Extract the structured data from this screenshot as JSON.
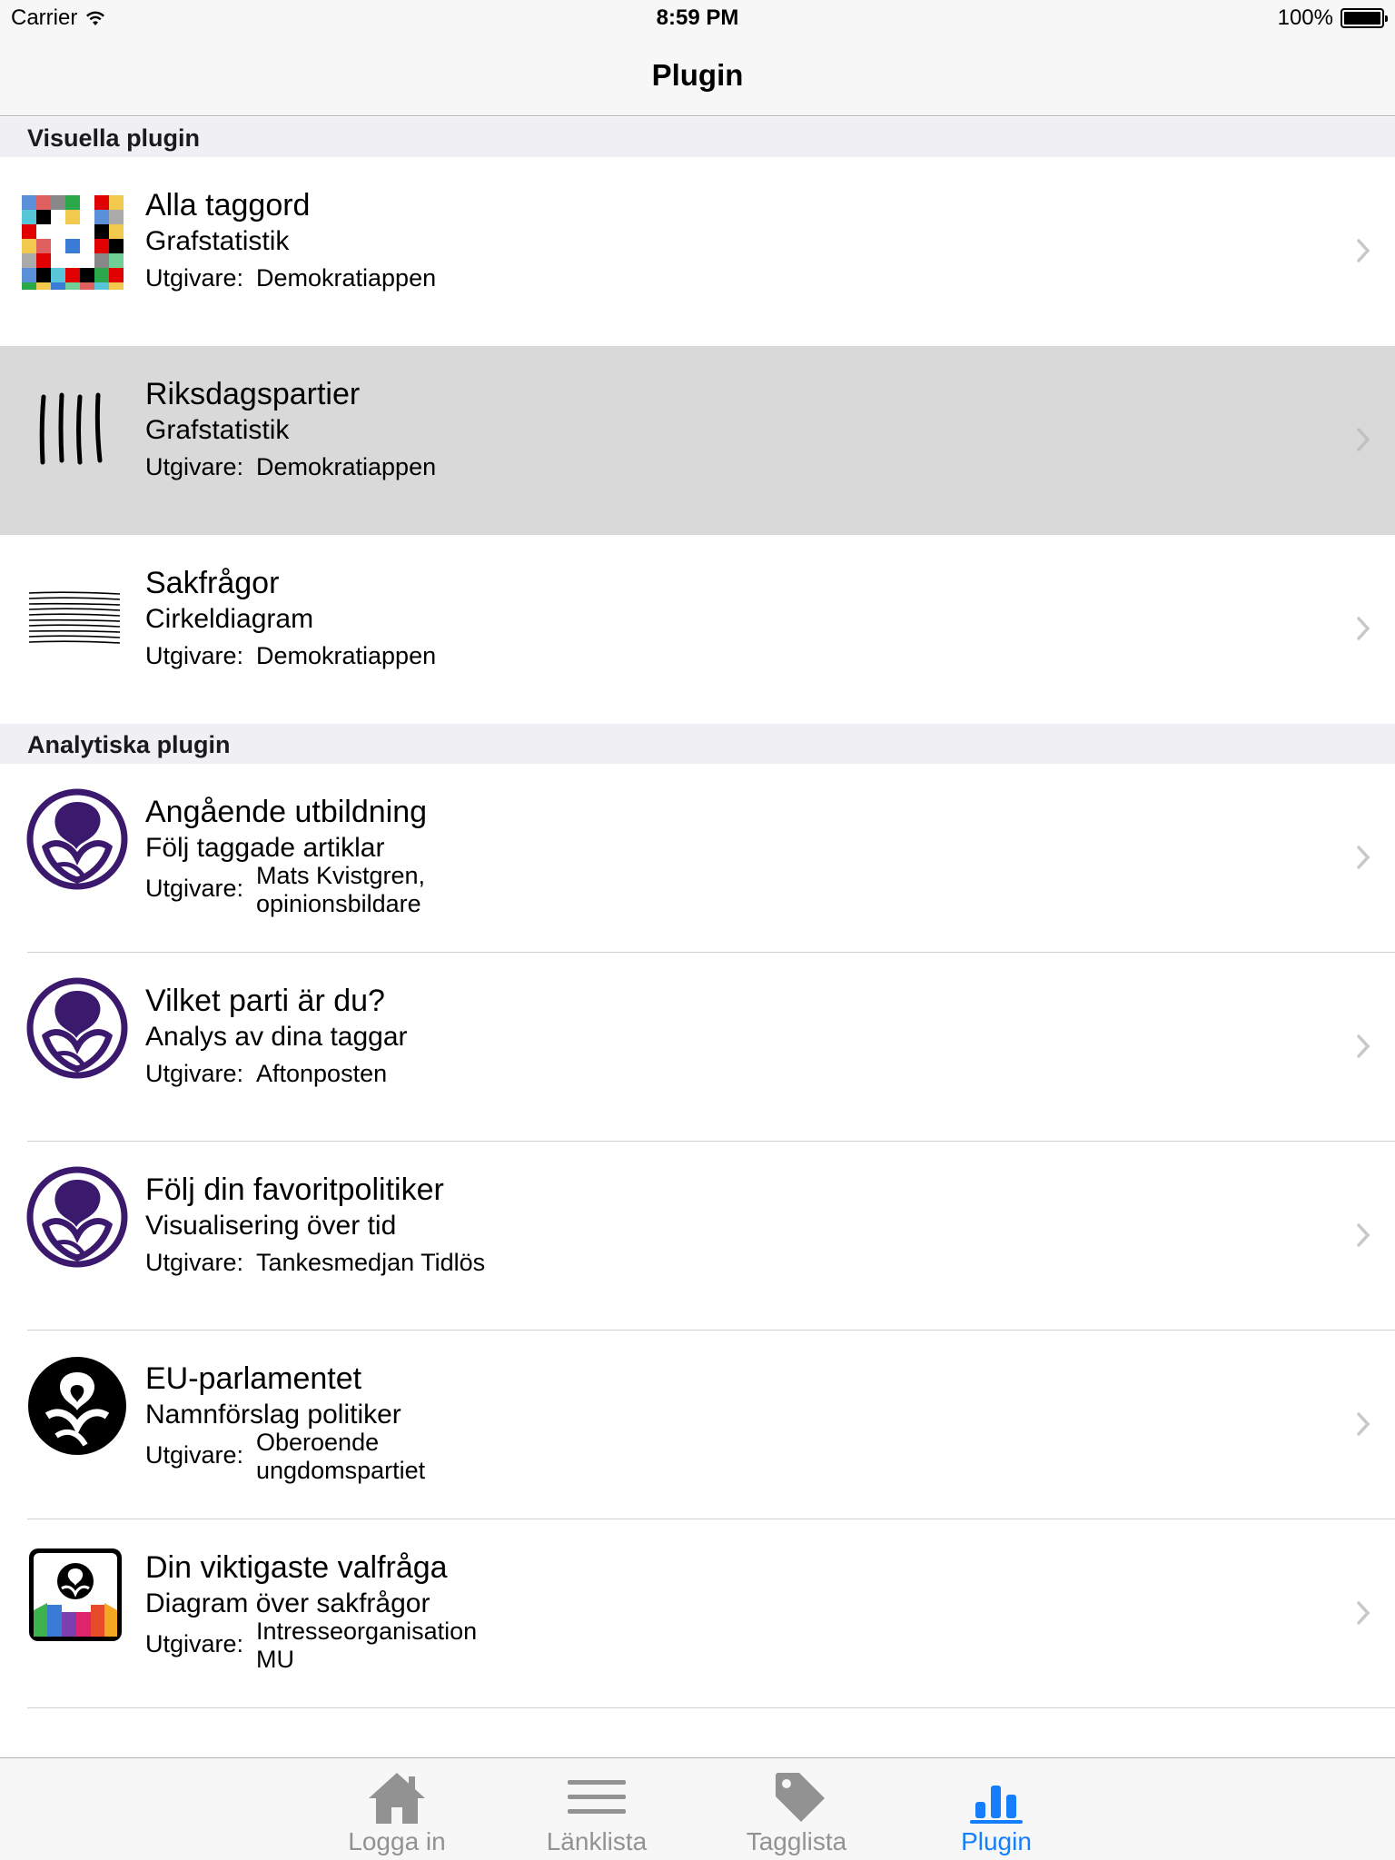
{
  "status_bar": {
    "carrier": "Carrier",
    "time": "8:59 PM",
    "battery": "100%",
    "battery_level": 1.0
  },
  "nav": {
    "title": "Plugin"
  },
  "sections": [
    {
      "header": "Visuella plugin",
      "rows": [
        {
          "title": "Alla taggord",
          "subtitle": "Grafstatistik",
          "publisher_label": "Utgivare:",
          "publisher": "Demokratiappen",
          "icon": "color-grid-icon",
          "selected": false
        },
        {
          "title": "Riksdagspartier",
          "subtitle": "Grafstatistik",
          "publisher_label": "Utgivare:",
          "publisher": "Demokratiappen",
          "icon": "tally-marks-icon",
          "selected": true
        },
        {
          "title": "Sakfrågor",
          "subtitle": "Cirkeldiagram",
          "publisher_label": "Utgivare:",
          "publisher": "Demokratiappen",
          "icon": "lines-icon",
          "selected": false
        }
      ]
    },
    {
      "header": "Analytiska plugin",
      "rows": [
        {
          "title": "Angående utbildning",
          "subtitle": "Följ taggade artiklar",
          "publisher_label": "Utgivare:",
          "publisher_line1": "Mats Kvistgren,",
          "publisher_line2": "opinionsbildare",
          "icon": "purple-logo-icon"
        },
        {
          "title": "Vilket parti är du?",
          "subtitle": "Analys av dina taggar",
          "publisher_label": "Utgivare:",
          "publisher": "Aftonposten",
          "icon": "purple-logo-icon"
        },
        {
          "title": "Följ din favoritpolitiker",
          "subtitle": "Visualisering över tid",
          "publisher_label": "Utgivare:",
          "publisher": "Tankesmedjan Tidlös",
          "icon": "purple-logo-icon"
        },
        {
          "title": "EU-parlamentet",
          "subtitle": "Namnförslag politiker",
          "publisher_label": "Utgivare:",
          "publisher_line1": "Oberoende",
          "publisher_line2": "ungdomspartiet",
          "icon": "black-logo-icon"
        },
        {
          "title": "Din viktigaste valfråga",
          "subtitle": "Diagram över sakfrågor",
          "publisher_label": "Utgivare:",
          "publisher_line1": "Intresseorganisation",
          "publisher_line2": "MU",
          "icon": "color-app-icon"
        }
      ]
    }
  ],
  "tab_bar": {
    "tabs": [
      {
        "label": "Logga in",
        "icon": "house-icon",
        "active": false
      },
      {
        "label": "Länklista",
        "icon": "list-icon",
        "active": false
      },
      {
        "label": "Tagglista",
        "icon": "tag-icon",
        "active": false
      },
      {
        "label": "Plugin",
        "icon": "bar-chart-icon",
        "active": true
      }
    ]
  },
  "colors": {
    "accent": "#147efb",
    "inactive_tab": "#929292",
    "logo_purple": "#3b1a6e",
    "selected_row": "#d9d9d9",
    "section_bg": "#efeff4"
  }
}
